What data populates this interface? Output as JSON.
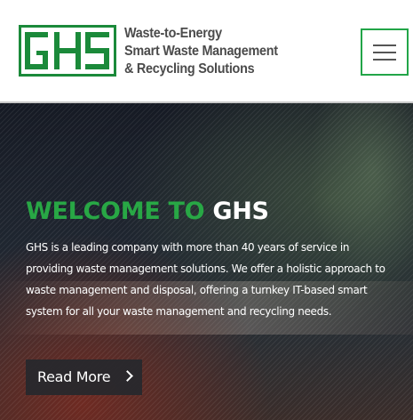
{
  "header": {
    "logo_text": "GHS",
    "tagline": [
      "Waste-to-Energy",
      "Smart Waste Management",
      "& Recycling Solutions"
    ],
    "menu_icon": "hamburger-menu-icon",
    "brand_color": "#1b8a3a",
    "menu_border_color": "#22a548"
  },
  "hero": {
    "title_prefix": "WELCOME TO ",
    "title_brand": "GHS",
    "title_prefix_color": "#28a745",
    "body_lines": [
      "GHS is a leading company with more than 40 years of service in",
      "providing waste management solutions. We offer a holistic approach to",
      "waste management and disposal, offering a turnkey IT-based smart",
      "system for all your waste management and recycling needs."
    ],
    "cta_label": "Read More",
    "cta_icon": "chevron-right-icon"
  }
}
